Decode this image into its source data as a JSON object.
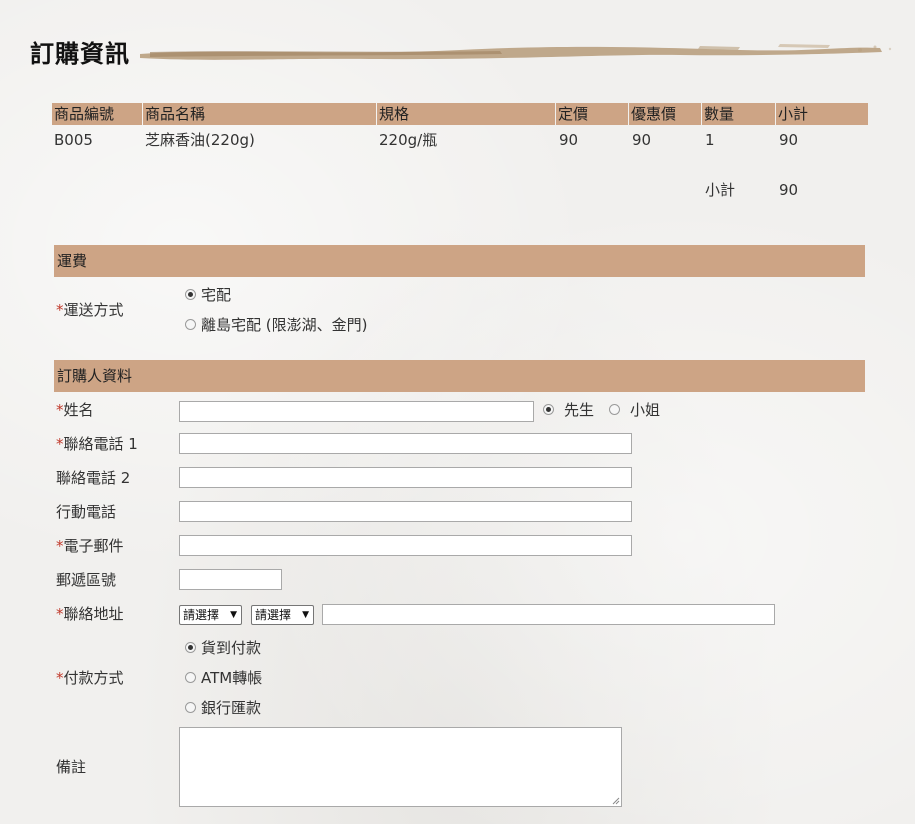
{
  "page": {
    "title": "訂購資訊"
  },
  "table": {
    "headers": [
      "商品編號",
      "商品名稱",
      "規格",
      "定價",
      "優惠價",
      "數量",
      "小計"
    ],
    "rows": [
      [
        "B005",
        "芝麻香油(220g)",
        "220g/瓶",
        "90",
        "90",
        "1",
        "90"
      ]
    ],
    "subtotal_label": "小計",
    "subtotal_value": "90"
  },
  "shipping": {
    "section_title": "運費",
    "method_label": "運送方式",
    "options": [
      "宅配",
      "離島宅配 (限澎湖、金門)"
    ],
    "selected": 0
  },
  "buyer": {
    "section_title": "訂購人資料",
    "required_mark": "*",
    "name_label": "姓名",
    "gender_options": [
      "先生",
      "小姐"
    ],
    "gender_selected": 0,
    "phone1_label": "聯絡電話 1",
    "phone2_label": "聯絡電話 2",
    "mobile_label": "行動電話",
    "email_label": "電子郵件",
    "zip_label": "郵遞區號",
    "address_label": "聯絡地址",
    "city_select": "請選擇",
    "district_select": "請選擇",
    "payment_label": "付款方式",
    "payment_options": [
      "貨到付款",
      "ATM轉帳",
      "銀行匯款"
    ],
    "payment_selected": 0,
    "note_label": "備註"
  },
  "colors": {
    "header_bg": "#cda485",
    "required": "#c0392b",
    "brush": "#b9a07f"
  }
}
